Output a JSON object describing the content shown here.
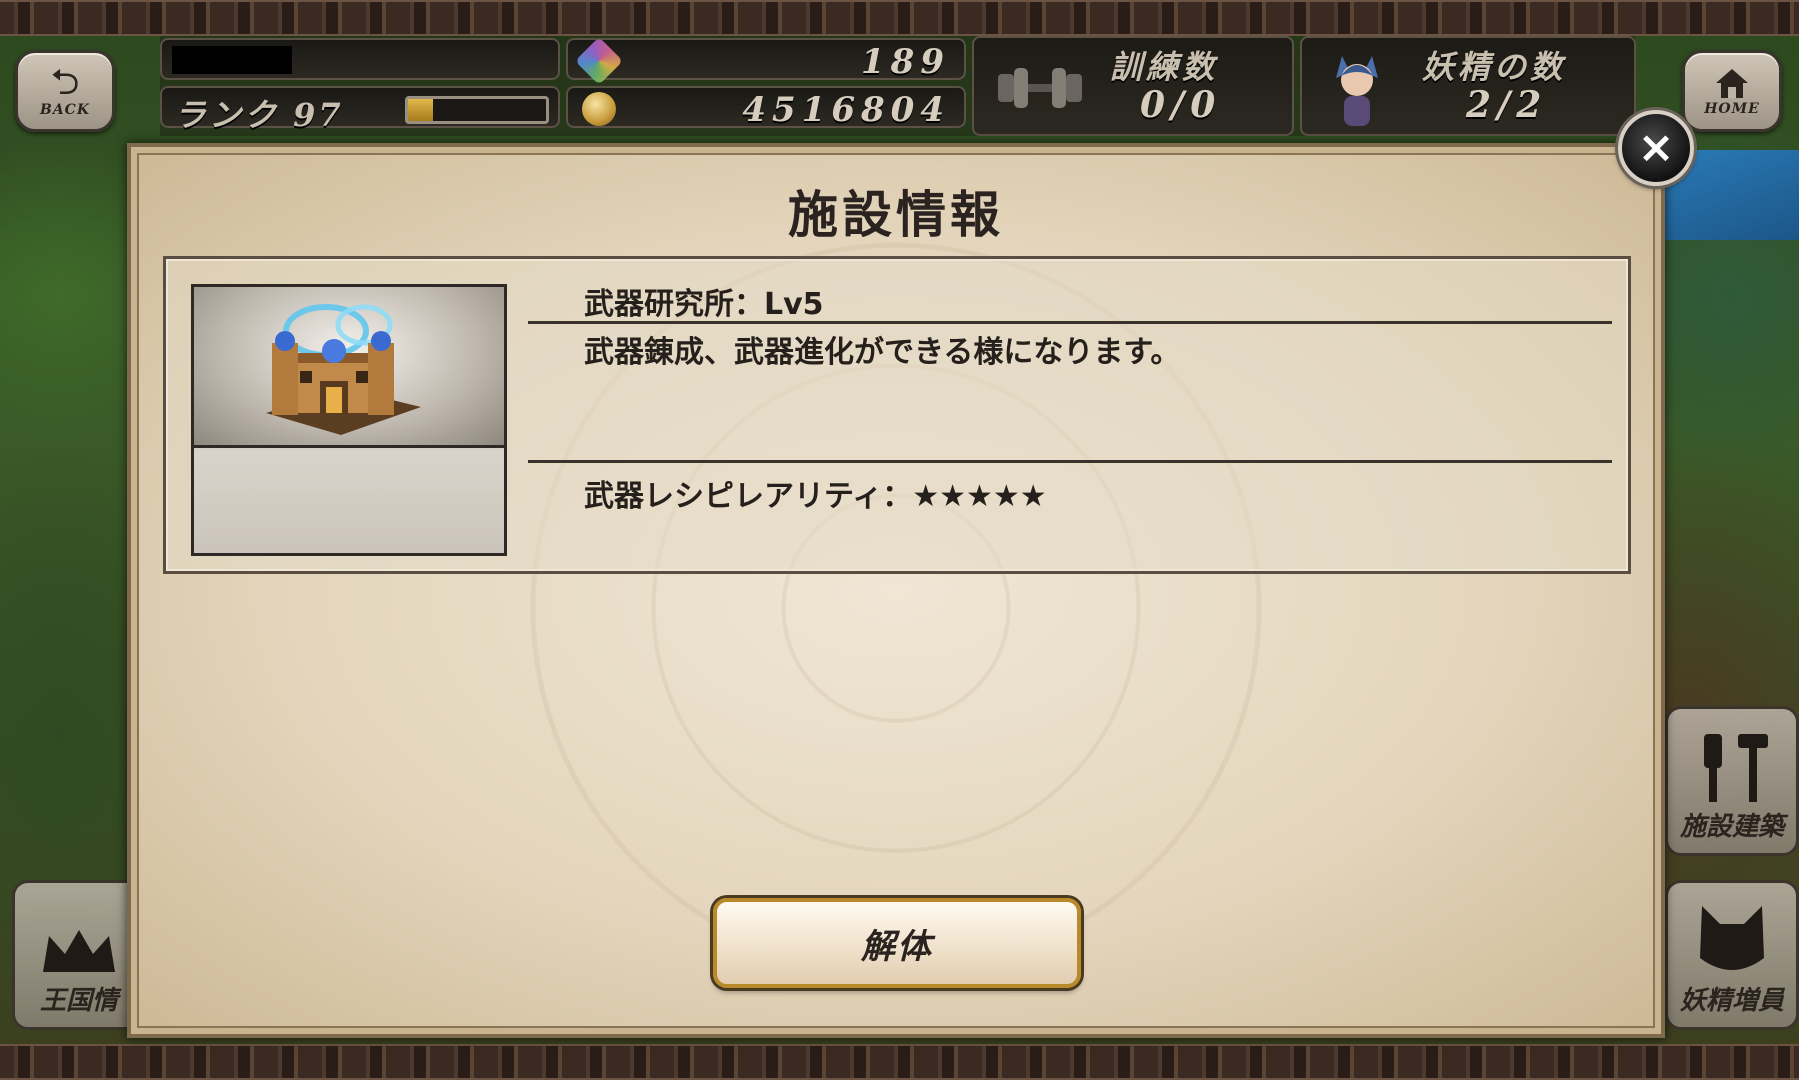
{
  "hud": {
    "back_label": "BACK",
    "home_label": "HOME",
    "player_name": "",
    "rank_label": "ランク 97",
    "rank_progress": 0.18,
    "gems": "189",
    "gold": "4516804",
    "training_title": "訓練数",
    "training_value": "0/0",
    "fairy_title": "妖精の数",
    "fairy_value": "2/2"
  },
  "side_buttons": {
    "kingdom_info": "王国情",
    "facility_build": "施設建築",
    "fairy_increase": "妖精増員"
  },
  "modal": {
    "title": "施設情報",
    "close_icon": "×",
    "facility_name": "武器研究所：Lv5",
    "description": "武器錬成、武器進化ができる様になります。",
    "rarity": "武器レシピレアリティ：★★★★★",
    "action_label": "解体"
  },
  "colors": {
    "accent_gold": "#b88a2a",
    "parchment": "#e4d6bd",
    "text_dark": "#26201c"
  },
  "icons": {
    "back": "back-arrow-icon",
    "home": "home-icon",
    "gem": "gem-icon",
    "coin": "coin-icon",
    "training": "dumbbell-icon",
    "fairy": "fairy-icon",
    "close": "close-icon",
    "kingdom": "crown-icon",
    "build": "tools-icon",
    "fairy_add": "cat-head-icon"
  }
}
